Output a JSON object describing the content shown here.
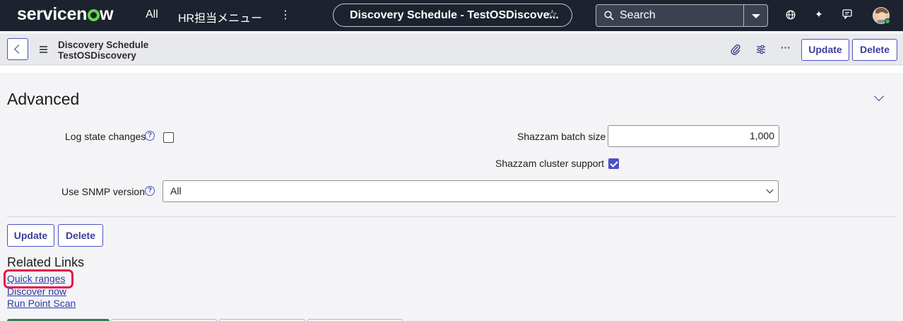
{
  "topnav": {
    "logo": "servicenow",
    "all_label": "All",
    "hr_menu_label": "HR担当メニュー",
    "more_label": "⋮",
    "context_title": "Discovery Schedule - TestOSDiscove...",
    "star": "☆",
    "search_label": "Search"
  },
  "form_header": {
    "title_line1": "Discovery Schedule",
    "title_line2": "TestOSDiscovery",
    "more_label": "···",
    "update_label": "Update",
    "delete_label": "Delete"
  },
  "section": {
    "title": "Advanced",
    "log_state_changes_label": "Log state changes",
    "log_state_changes_checked": false,
    "shazzam_batch_size_label": "Shazzam batch size",
    "shazzam_batch_size_value": "1,000",
    "shazzam_cluster_support_label": "Shazzam cluster support",
    "shazzam_cluster_support_checked": true,
    "use_snmp_version_label": "Use SNMP version",
    "use_snmp_version_value": "All",
    "help_glyph": "?"
  },
  "form_buttons": {
    "update_label": "Update",
    "delete_label": "Delete"
  },
  "related_links": {
    "title": "Related Links",
    "links": [
      "Quick ranges",
      "Discover now",
      "Run Point Scan"
    ]
  },
  "colors": {
    "topnav_bg": "#1c222e",
    "accent": "#4b51c6",
    "highlight": "#e3174b",
    "brand_green": "#62d84e"
  }
}
